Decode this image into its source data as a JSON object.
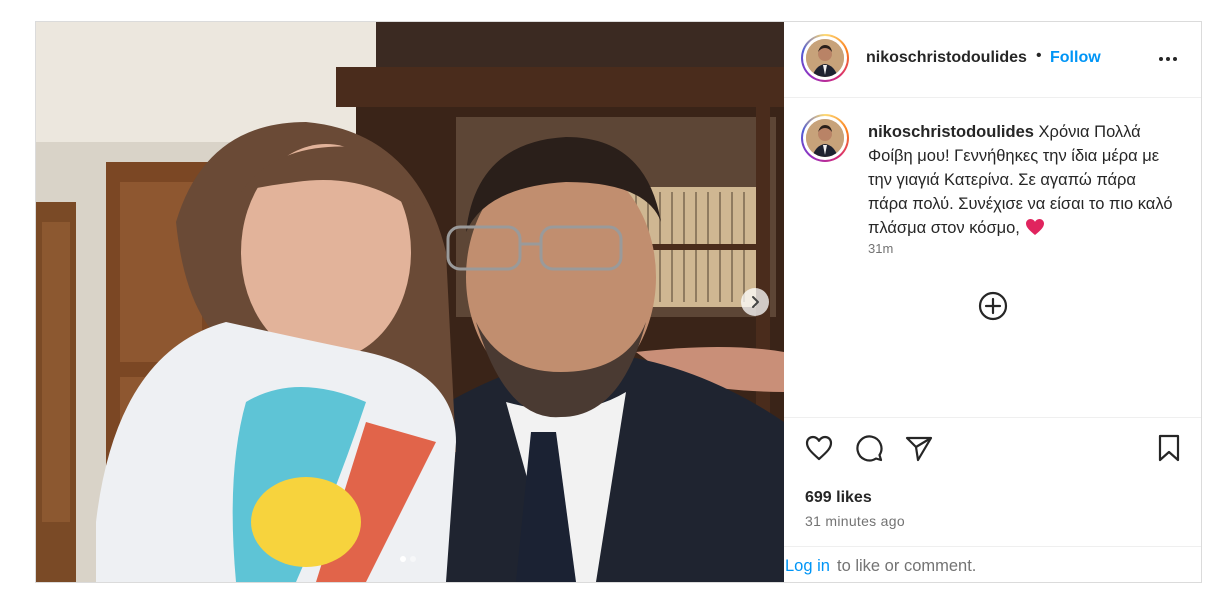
{
  "post": {
    "username": "nikoschristodoulides",
    "separator": "•",
    "follow_label": "Follow",
    "caption_text": "Χρόνια Πολλά Φοίβη μου! Γεννήθηκες την ίδια μέρα με την γιαγιά Κατερίνα. Σε αγαπώ πάρα πάρα πολύ. Συνέχισε να είσαι το πιο καλό πλάσμα στον κόσμο,",
    "caption_emoji": "❤️",
    "caption_time": "31m",
    "likes": "699 likes",
    "posted_ago": "31 minutes ago",
    "login_link": "Log in",
    "login_text": "to like or comment.",
    "carousel": {
      "slide_count": 2,
      "active_index": 0
    }
  },
  "icons": {
    "more": "more-options-icon",
    "next": "chevron-right-icon",
    "add_comment": "plus-circle-icon",
    "like": "heart-icon",
    "comment": "comment-icon",
    "share": "send-icon",
    "save": "bookmark-icon",
    "caption_heart": "red-heart-emoji"
  },
  "colors": {
    "accent": "#0095f6",
    "text": "#262626",
    "secondary": "#737373",
    "border": "#dbdbdb",
    "heart": "#e0245e"
  }
}
